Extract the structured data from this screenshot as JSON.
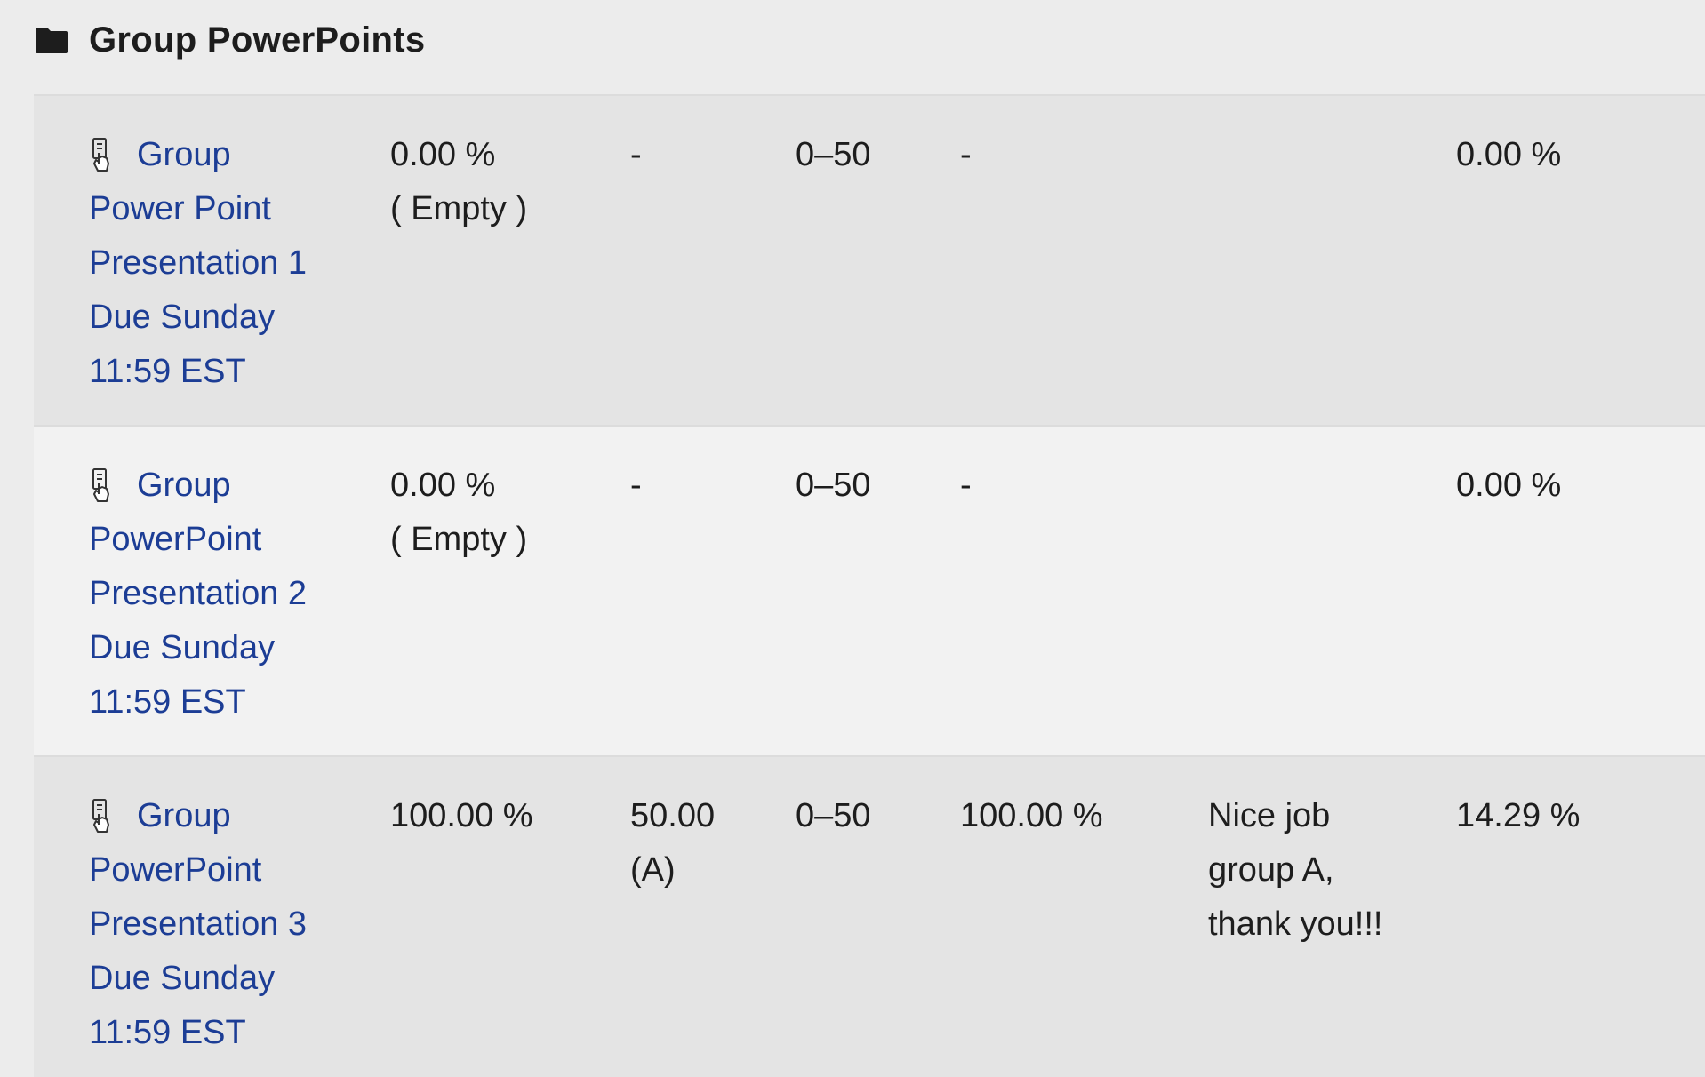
{
  "category": {
    "title": "Group PowerPoints",
    "icon": "folder-icon"
  },
  "rows": [
    {
      "item_lines": [
        "Group",
        "Power Point",
        "Presentation 1",
        "Due Sunday",
        "11:59 EST"
      ],
      "item_icon": "assignment-icon",
      "weight_lines": [
        "0.00 %",
        "( Empty )"
      ],
      "grade_lines": [
        "-"
      ],
      "range": "0–50",
      "percentage": "-",
      "feedback_lines": [],
      "contribution": "0.00 %"
    },
    {
      "item_lines": [
        "Group",
        "PowerPoint",
        "Presentation 2",
        "Due Sunday",
        "11:59 EST"
      ],
      "item_icon": "assignment-icon",
      "weight_lines": [
        "0.00 %",
        "( Empty )"
      ],
      "grade_lines": [
        "-"
      ],
      "range": "0–50",
      "percentage": "-",
      "feedback_lines": [],
      "contribution": "0.00 %"
    },
    {
      "item_lines": [
        "Group",
        "PowerPoint",
        "Presentation 3",
        "Due Sunday",
        "11:59 EST"
      ],
      "item_icon": "assignment-icon",
      "weight_lines": [
        "100.00 %"
      ],
      "grade_lines": [
        "50.00",
        "(A)"
      ],
      "range": "0–50",
      "percentage": "100.00 %",
      "feedback_lines": [
        "Nice job",
        "group A,",
        "thank you!!!"
      ],
      "contribution": "14.29 %"
    }
  ],
  "colors": {
    "link": "#1c3d95",
    "row_odd": "#e4e4e4",
    "row_even": "#f2f2f2",
    "background": "#ececec"
  }
}
